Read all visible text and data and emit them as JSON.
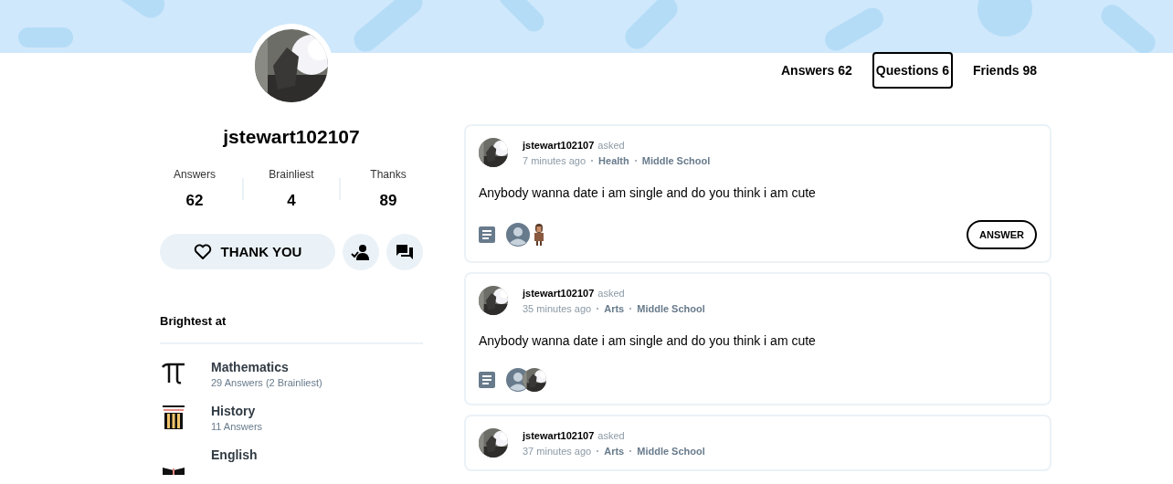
{
  "profile": {
    "username": "jstewart102107",
    "stats": [
      {
        "label": "Answers",
        "value": "62"
      },
      {
        "label": "Brainliest",
        "value": "4"
      },
      {
        "label": "Thanks",
        "value": "89"
      }
    ],
    "thank_button": "THANK YOU"
  },
  "brightest": {
    "title": "Brightest at",
    "subjects": [
      {
        "kind": "pi",
        "name": "Mathematics",
        "detail": "29 Answers (2 Brainliest)"
      },
      {
        "kind": "columns",
        "name": "History",
        "detail": "11 Answers"
      },
      {
        "kind": "book",
        "name": "English"
      }
    ]
  },
  "tabs": [
    {
      "label": "Answers 62",
      "selected": false
    },
    {
      "label": "Questions 6",
      "selected": true
    },
    {
      "label": "Friends 98",
      "selected": false
    }
  ],
  "questions": [
    {
      "author": "jstewart102107",
      "action": "asked",
      "time": "7 minutes ago",
      "subject": "Health",
      "level": "Middle School",
      "text": "Anybody wanna date i am single and do you think i am cute",
      "helpers": [
        {
          "kind": "silhouette"
        },
        {
          "kind": "figure"
        }
      ],
      "answer_button": "ANSWER"
    },
    {
      "author": "jstewart102107",
      "action": "asked",
      "time": "35 minutes ago",
      "subject": "Arts",
      "level": "Middle School",
      "text": "Anybody wanna date i am single and do you think i am cute",
      "helpers": [
        {
          "kind": "silhouette"
        },
        {
          "kind": "picture"
        }
      ]
    },
    {
      "author": "jstewart102107",
      "action": "asked",
      "time": "37 minutes ago",
      "subject": "Arts",
      "level": "Middle School"
    }
  ]
}
